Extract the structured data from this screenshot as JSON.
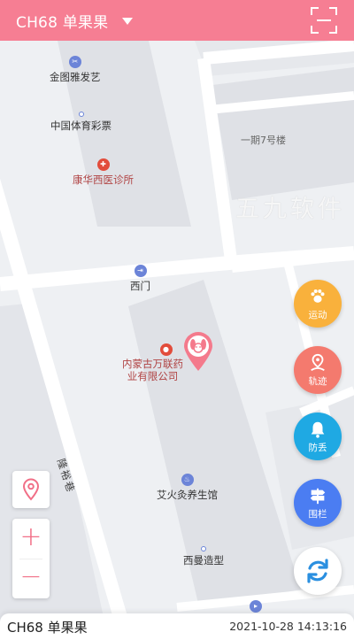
{
  "header": {
    "device_title": "CH68 单果果",
    "scan_icon": "scan-icon"
  },
  "map": {
    "watermark": "五九软件",
    "pois": {
      "salon": "金图雅发艺",
      "lottery": "中国体育彩票",
      "clinic": "康华西医诊所",
      "building7": "一期7号楼",
      "west_gate": "西门",
      "pharmacy_line1": "内蒙古万联药",
      "pharmacy_line2": "业有限公司",
      "moxibustion": "艾火灸养生馆",
      "hair_studio": "西曼造型"
    },
    "road": "隆裕巷"
  },
  "side_buttons": {
    "sport": {
      "label": "运动",
      "icon": "paw-icon",
      "color": "#f9b13c"
    },
    "track": {
      "label": "轨迹",
      "icon": "track-pin-icon",
      "color": "#f47a6e"
    },
    "anti_loss": {
      "label": "防丢",
      "icon": "bell-icon",
      "color": "#1fa9e3"
    },
    "fence": {
      "label": "围栏",
      "icon": "signpost-icon",
      "color": "#4b7df2"
    }
  },
  "controls": {
    "refresh_icon": "refresh-icon",
    "locate_icon": "location-pin-icon",
    "zoom_in": "+",
    "zoom_out": "−"
  },
  "info_card": {
    "device_name": "CH68 单果果",
    "timestamp": "2021-10-28 14:13:16"
  },
  "colors": {
    "header": "#f67e93",
    "accent": "#f16f87"
  }
}
